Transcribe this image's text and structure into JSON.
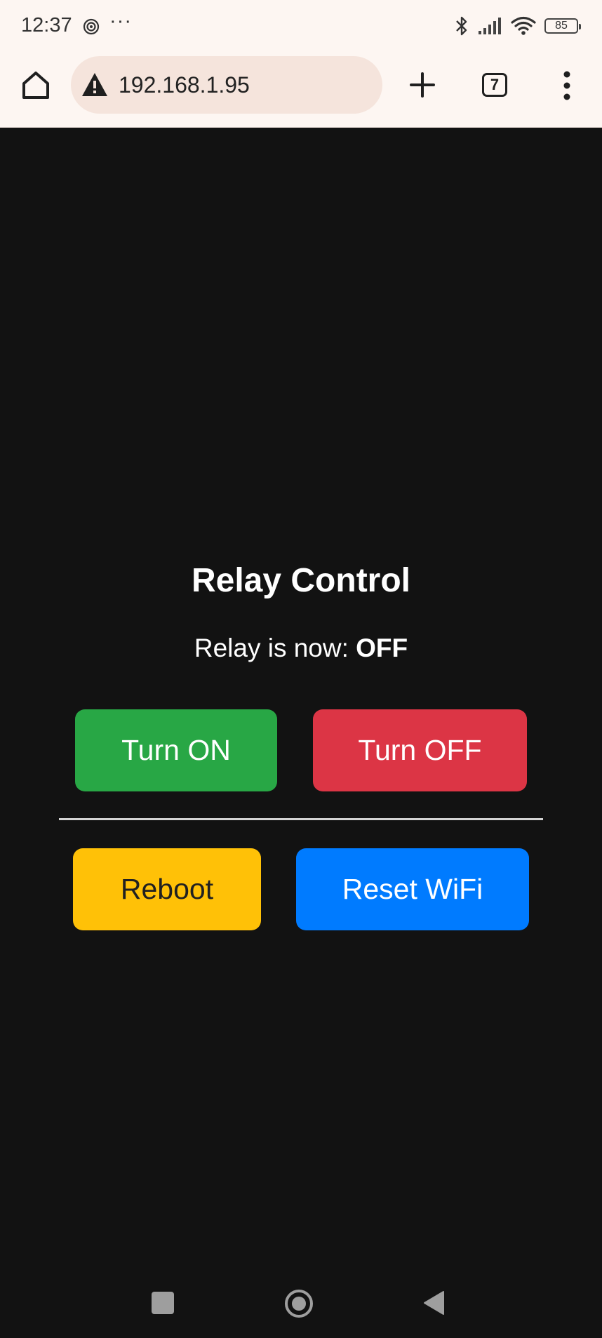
{
  "status_bar": {
    "time": "12:37",
    "more": "···",
    "battery": "85"
  },
  "browser": {
    "url": "192.168.1.95",
    "tab_count": "7"
  },
  "page": {
    "title": "Relay Control",
    "status_prefix": "Relay is now: ",
    "status_value": "OFF",
    "buttons": {
      "on": "Turn ON",
      "off": "Turn OFF",
      "reboot": "Reboot",
      "reset_wifi": "Reset WiFi"
    }
  },
  "colors": {
    "on": "#28a745",
    "off": "#dc3545",
    "reboot": "#ffc107",
    "reset_wifi": "#007bff",
    "background": "#121212"
  }
}
